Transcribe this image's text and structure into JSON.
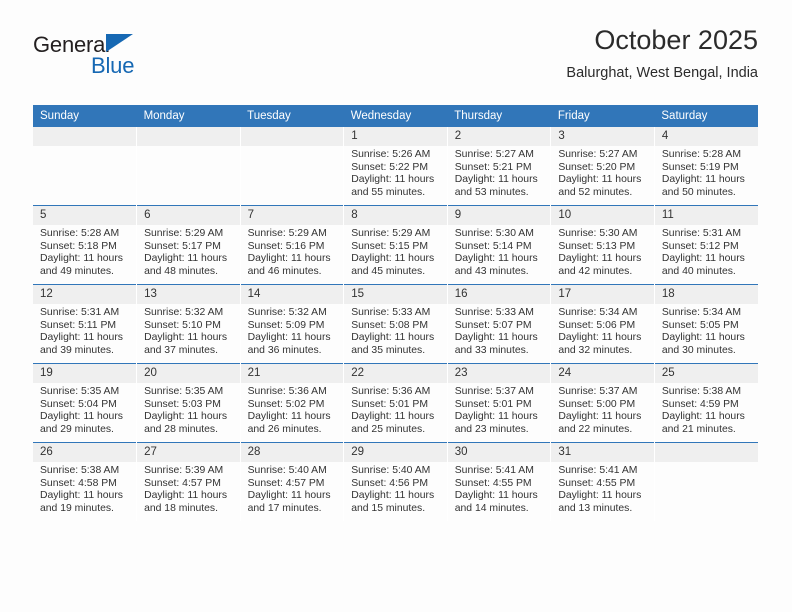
{
  "brand": {
    "name_part1": "General",
    "name_part2": "Blue",
    "triangle_color": "#1668b3"
  },
  "header": {
    "title": "October 2025",
    "subtitle": "Balurghat, West Bengal, India"
  },
  "theme": {
    "header_blue": "#3176b9",
    "daynum_gray": "#efefef",
    "page_bg": "#fdfdfd",
    "text": "#333333"
  },
  "weekday_headers": [
    "Sunday",
    "Monday",
    "Tuesday",
    "Wednesday",
    "Thursday",
    "Friday",
    "Saturday"
  ],
  "labels": {
    "sunrise_prefix": "Sunrise:",
    "sunset_prefix": "Sunset:",
    "daylight_prefix": "Daylight:"
  },
  "weeks": [
    [
      {
        "day": "",
        "empty": true
      },
      {
        "day": "",
        "empty": true
      },
      {
        "day": "",
        "empty": true
      },
      {
        "day": "1",
        "sunrise": "Sunrise: 5:26 AM",
        "sunset": "Sunset: 5:22 PM",
        "daylight_1": "Daylight: 11 hours",
        "daylight_2": "and 55 minutes."
      },
      {
        "day": "2",
        "sunrise": "Sunrise: 5:27 AM",
        "sunset": "Sunset: 5:21 PM",
        "daylight_1": "Daylight: 11 hours",
        "daylight_2": "and 53 minutes."
      },
      {
        "day": "3",
        "sunrise": "Sunrise: 5:27 AM",
        "sunset": "Sunset: 5:20 PM",
        "daylight_1": "Daylight: 11 hours",
        "daylight_2": "and 52 minutes."
      },
      {
        "day": "4",
        "sunrise": "Sunrise: 5:28 AM",
        "sunset": "Sunset: 5:19 PM",
        "daylight_1": "Daylight: 11 hours",
        "daylight_2": "and 50 minutes."
      }
    ],
    [
      {
        "day": "5",
        "sunrise": "Sunrise: 5:28 AM",
        "sunset": "Sunset: 5:18 PM",
        "daylight_1": "Daylight: 11 hours",
        "daylight_2": "and 49 minutes."
      },
      {
        "day": "6",
        "sunrise": "Sunrise: 5:29 AM",
        "sunset": "Sunset: 5:17 PM",
        "daylight_1": "Daylight: 11 hours",
        "daylight_2": "and 48 minutes."
      },
      {
        "day": "7",
        "sunrise": "Sunrise: 5:29 AM",
        "sunset": "Sunset: 5:16 PM",
        "daylight_1": "Daylight: 11 hours",
        "daylight_2": "and 46 minutes."
      },
      {
        "day": "8",
        "sunrise": "Sunrise: 5:29 AM",
        "sunset": "Sunset: 5:15 PM",
        "daylight_1": "Daylight: 11 hours",
        "daylight_2": "and 45 minutes."
      },
      {
        "day": "9",
        "sunrise": "Sunrise: 5:30 AM",
        "sunset": "Sunset: 5:14 PM",
        "daylight_1": "Daylight: 11 hours",
        "daylight_2": "and 43 minutes."
      },
      {
        "day": "10",
        "sunrise": "Sunrise: 5:30 AM",
        "sunset": "Sunset: 5:13 PM",
        "daylight_1": "Daylight: 11 hours",
        "daylight_2": "and 42 minutes."
      },
      {
        "day": "11",
        "sunrise": "Sunrise: 5:31 AM",
        "sunset": "Sunset: 5:12 PM",
        "daylight_1": "Daylight: 11 hours",
        "daylight_2": "and 40 minutes."
      }
    ],
    [
      {
        "day": "12",
        "sunrise": "Sunrise: 5:31 AM",
        "sunset": "Sunset: 5:11 PM",
        "daylight_1": "Daylight: 11 hours",
        "daylight_2": "and 39 minutes."
      },
      {
        "day": "13",
        "sunrise": "Sunrise: 5:32 AM",
        "sunset": "Sunset: 5:10 PM",
        "daylight_1": "Daylight: 11 hours",
        "daylight_2": "and 37 minutes."
      },
      {
        "day": "14",
        "sunrise": "Sunrise: 5:32 AM",
        "sunset": "Sunset: 5:09 PM",
        "daylight_1": "Daylight: 11 hours",
        "daylight_2": "and 36 minutes."
      },
      {
        "day": "15",
        "sunrise": "Sunrise: 5:33 AM",
        "sunset": "Sunset: 5:08 PM",
        "daylight_1": "Daylight: 11 hours",
        "daylight_2": "and 35 minutes."
      },
      {
        "day": "16",
        "sunrise": "Sunrise: 5:33 AM",
        "sunset": "Sunset: 5:07 PM",
        "daylight_1": "Daylight: 11 hours",
        "daylight_2": "and 33 minutes."
      },
      {
        "day": "17",
        "sunrise": "Sunrise: 5:34 AM",
        "sunset": "Sunset: 5:06 PM",
        "daylight_1": "Daylight: 11 hours",
        "daylight_2": "and 32 minutes."
      },
      {
        "day": "18",
        "sunrise": "Sunrise: 5:34 AM",
        "sunset": "Sunset: 5:05 PM",
        "daylight_1": "Daylight: 11 hours",
        "daylight_2": "and 30 minutes."
      }
    ],
    [
      {
        "day": "19",
        "sunrise": "Sunrise: 5:35 AM",
        "sunset": "Sunset: 5:04 PM",
        "daylight_1": "Daylight: 11 hours",
        "daylight_2": "and 29 minutes."
      },
      {
        "day": "20",
        "sunrise": "Sunrise: 5:35 AM",
        "sunset": "Sunset: 5:03 PM",
        "daylight_1": "Daylight: 11 hours",
        "daylight_2": "and 28 minutes."
      },
      {
        "day": "21",
        "sunrise": "Sunrise: 5:36 AM",
        "sunset": "Sunset: 5:02 PM",
        "daylight_1": "Daylight: 11 hours",
        "daylight_2": "and 26 minutes."
      },
      {
        "day": "22",
        "sunrise": "Sunrise: 5:36 AM",
        "sunset": "Sunset: 5:01 PM",
        "daylight_1": "Daylight: 11 hours",
        "daylight_2": "and 25 minutes."
      },
      {
        "day": "23",
        "sunrise": "Sunrise: 5:37 AM",
        "sunset": "Sunset: 5:01 PM",
        "daylight_1": "Daylight: 11 hours",
        "daylight_2": "and 23 minutes."
      },
      {
        "day": "24",
        "sunrise": "Sunrise: 5:37 AM",
        "sunset": "Sunset: 5:00 PM",
        "daylight_1": "Daylight: 11 hours",
        "daylight_2": "and 22 minutes."
      },
      {
        "day": "25",
        "sunrise": "Sunrise: 5:38 AM",
        "sunset": "Sunset: 4:59 PM",
        "daylight_1": "Daylight: 11 hours",
        "daylight_2": "and 21 minutes."
      }
    ],
    [
      {
        "day": "26",
        "sunrise": "Sunrise: 5:38 AM",
        "sunset": "Sunset: 4:58 PM",
        "daylight_1": "Daylight: 11 hours",
        "daylight_2": "and 19 minutes."
      },
      {
        "day": "27",
        "sunrise": "Sunrise: 5:39 AM",
        "sunset": "Sunset: 4:57 PM",
        "daylight_1": "Daylight: 11 hours",
        "daylight_2": "and 18 minutes."
      },
      {
        "day": "28",
        "sunrise": "Sunrise: 5:40 AM",
        "sunset": "Sunset: 4:57 PM",
        "daylight_1": "Daylight: 11 hours",
        "daylight_2": "and 17 minutes."
      },
      {
        "day": "29",
        "sunrise": "Sunrise: 5:40 AM",
        "sunset": "Sunset: 4:56 PM",
        "daylight_1": "Daylight: 11 hours",
        "daylight_2": "and 15 minutes."
      },
      {
        "day": "30",
        "sunrise": "Sunrise: 5:41 AM",
        "sunset": "Sunset: 4:55 PM",
        "daylight_1": "Daylight: 11 hours",
        "daylight_2": "and 14 minutes."
      },
      {
        "day": "31",
        "sunrise": "Sunrise: 5:41 AM",
        "sunset": "Sunset: 4:55 PM",
        "daylight_1": "Daylight: 11 hours",
        "daylight_2": "and 13 minutes."
      },
      {
        "day": "",
        "empty": true
      }
    ]
  ]
}
